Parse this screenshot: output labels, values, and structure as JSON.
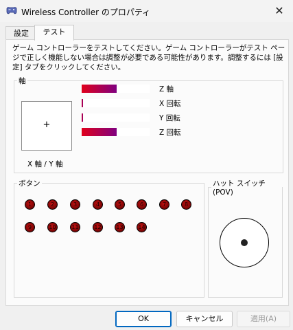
{
  "window": {
    "title": "Wireless Controller のプロパティ",
    "close_glyph": "✕"
  },
  "tabs": [
    {
      "label": "設定"
    },
    {
      "label": "テスト"
    }
  ],
  "description": "ゲーム コントローラーをテストしてください。ゲーム コントローラーがテスト ページで正しく機能しない場合は調整が必要である可能性があります。調整するには [設定] タブをクリックしてください。",
  "axes": {
    "group_label": "軸",
    "xy_crosshair": "+",
    "xy_label": "X 軸 / Y 軸",
    "bars": [
      {
        "label": "Z 軸",
        "level": 0.52
      },
      {
        "label": "X 回転",
        "level": 0.02
      },
      {
        "label": "Y 回転",
        "level": 0.02
      },
      {
        "label": "Z 回転",
        "level": 0.52
      }
    ]
  },
  "buttons": {
    "group_label": "ボタン",
    "items": [
      "1",
      "2",
      "3",
      "4",
      "5",
      "6",
      "7",
      "8",
      "9",
      "10",
      "11",
      "12",
      "13",
      "14"
    ]
  },
  "pov": {
    "group_label": "ハット スイッチ (POV)"
  },
  "footer": {
    "ok_label": "OK",
    "cancel_label": "キャンセル",
    "apply_label": "適用(A)"
  }
}
